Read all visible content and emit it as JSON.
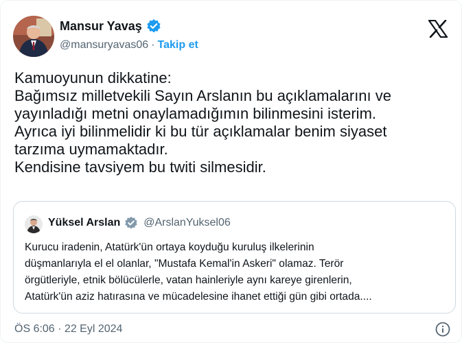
{
  "author": {
    "name": "Mansur Yavaş",
    "handle": "@mansuryavas06",
    "separator": "·",
    "follow_label": "Takip et"
  },
  "tweet": {
    "lines": [
      "Kamuoyunun dikkatine:",
      "Bağımsız milletvekili Sayın Arslanın bu açıklamalarını ve",
      "yayınladığı metni onaylamadığımın bilinmesini isterim.",
      "Ayrıca iyi bilinmelidir ki bu tür açıklamalar benim siyaset",
      "tarzıma uymamaktadır.",
      "Kendisine tavsiyem bu twiti silmesidir."
    ]
  },
  "quote": {
    "name": "Yüksel Arslan",
    "handle": "@ArslanYuksel06",
    "lines": [
      "Kurucu iradenin, Atatürk'ün ortaya koyduğu kuruluş ilkelerinin",
      "düşmanlarıyla el el olanlar, \"Mustafa Kemal'in Askeri\" olamaz. Terör",
      "örgütleriyle, etnik bölücülerle, vatan hainleriyle aynı kareye girenlerin,",
      "Atatürk'ün aziz hatırasına ve mücadelesine ihanet ettiği gün gibi ortada...."
    ]
  },
  "footer": {
    "timestamp": "ÖS 6:06 · 22 Eyl 2024"
  },
  "colors": {
    "accent": "#1d9bf0",
    "text": "#0f1419",
    "secondary": "#536471",
    "border": "#cfd9de"
  },
  "icons": {
    "verified": "verified-badge-icon",
    "platform": "x-logo-icon",
    "info": "info-icon"
  }
}
